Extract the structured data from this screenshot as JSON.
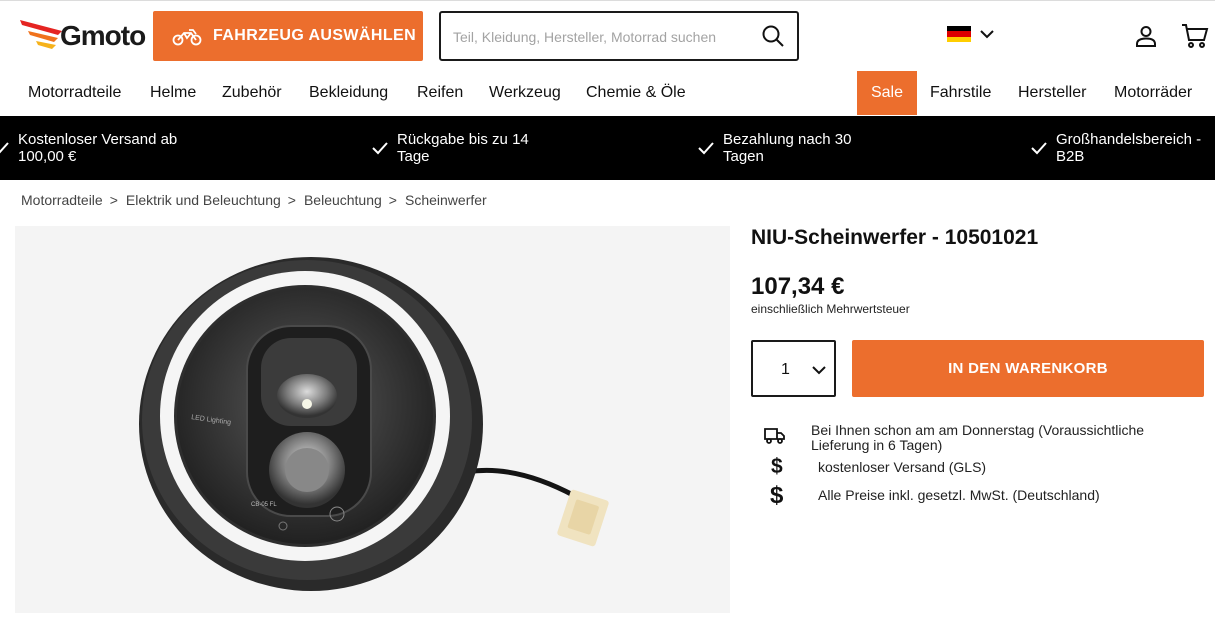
{
  "header": {
    "logo_text": "Gmoto",
    "vehicle_button": "FAHRZEUG AUSWÄHLEN",
    "search_placeholder": "Teil, Kleidung, Hersteller, Motorrad suchen",
    "colors": {
      "accent": "#ec6e2d",
      "logo_red": "#e52421",
      "logo_yellow": "#f6b21b"
    }
  },
  "nav": {
    "items": [
      "Motorradteile",
      "Helme",
      "Zubehör",
      "Bekleidung",
      "Reifen",
      "Werkzeug",
      "Chemie & Öle",
      "Sale",
      "Fahrstile",
      "Hersteller",
      "Motorräder"
    ]
  },
  "benefits": [
    "Kostenloser Versand ab 100,00 €",
    "Rückgabe bis zu 14 Tage",
    "Bezahlung nach 30 Tagen",
    "Großhandelsbereich - B2B"
  ],
  "breadcrumb": [
    "Motorradteile",
    "Elektrik und Beleuchtung",
    "Beleuchtung",
    "Scheinwerfer"
  ],
  "product": {
    "title": "NIU-Scheinwerfer - 10501021",
    "price": "107,34 €",
    "vat_note": "einschließlich Mehrwertsteuer",
    "quantity": "1",
    "add_to_cart": "IN DEN WARENKORB",
    "image_texts": [
      "LED Lighting",
      "CB-05 FL"
    ],
    "delivery": "Bei Ihnen schon am am Donnerstag (Voraussichtliche Lieferung in 6 Tagen)",
    "shipping": "kostenloser Versand (GLS)",
    "prices_note": "Alle Preise inkl. gesetzl. MwSt. (Deutschland)"
  },
  "icons": [
    "motorcycle-icon",
    "search-icon",
    "flag-de-icon",
    "chevron-down-icon",
    "account-icon",
    "cart-icon",
    "check-icon",
    "truck-icon",
    "dollar-icon"
  ]
}
